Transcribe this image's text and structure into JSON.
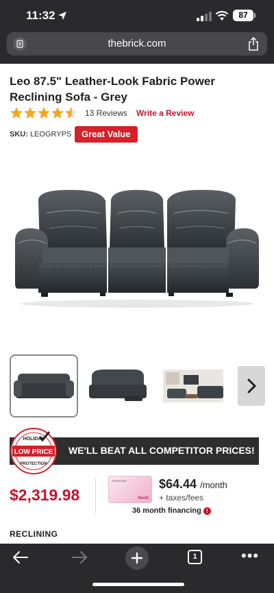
{
  "status_bar": {
    "time": "11:32",
    "battery": "87"
  },
  "browser": {
    "url": "thebrick.com"
  },
  "product": {
    "title": "Leo 87.5\" Leather-Look Fabric Power Reclining Sofa - Grey",
    "rating": 4.5,
    "reviews": "13 Reviews",
    "write_review": "Write a Review",
    "sku_label": "SKU:",
    "sku_value": "LEOGRYPS",
    "badge": "Great Value"
  },
  "promo": {
    "text": "WE'LL BEAT ALL COMPETITOR PRICES!",
    "seal_top": "HOLIDAY",
    "seal_middle": "LOW PRICE",
    "seal_bottom": "PROTECTION"
  },
  "pricing": {
    "price": "$2,319.98",
    "monthly_amount": "$64.44",
    "monthly_unit": "/month",
    "taxes": "+ taxes/fees",
    "financing": "36 month financing",
    "card_brand": "flexiti",
    "card_label": "FlexitiCard"
  },
  "section": {
    "heading": "RECLINING"
  },
  "toolbar": {
    "tab_count": "1"
  },
  "colors": {
    "accent": "#c8102e",
    "star": "#f5a623",
    "chrome": "#2a2a2c"
  }
}
